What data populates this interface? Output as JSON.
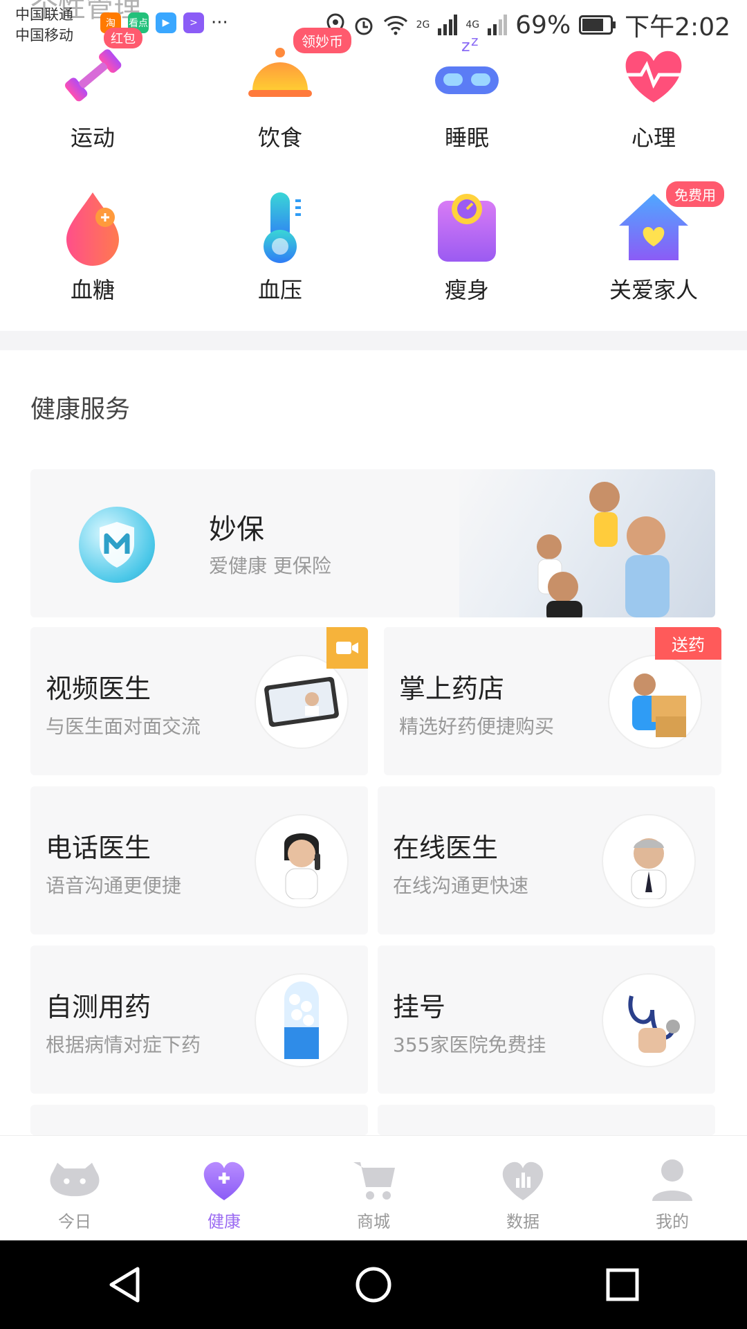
{
  "status_bar": {
    "carrier1": "中国联通",
    "carrier2": "中国移动",
    "faded_title": "个性管理",
    "app_icons": [
      {
        "label": "淘",
        "color": "#ff7a00"
      },
      {
        "label": "看点",
        "color": "#22c07a"
      },
      {
        "label": "▶",
        "color": "#3aa7ff"
      },
      {
        "label": ">",
        "color": "#8b5cf6"
      }
    ],
    "more": "···",
    "signal1": "2G",
    "signal2": "4G",
    "battery": "69%",
    "time": "下午2:02",
    "red_packet_badge": "红包"
  },
  "categories": [
    {
      "label": "运动",
      "icon": "dumbbell-icon"
    },
    {
      "label": "饮食",
      "icon": "food-cloche-icon"
    },
    {
      "label": "睡眠",
      "icon": "sleep-mask-icon"
    },
    {
      "label": "心理",
      "icon": "heart-pulse-icon"
    },
    {
      "label": "血糖",
      "icon": "blood-drop-icon"
    },
    {
      "label": "血压",
      "icon": "thermometer-icon"
    },
    {
      "label": "瘦身",
      "icon": "scale-icon"
    },
    {
      "label": "关爱家人",
      "icon": "house-heart-icon"
    }
  ],
  "badges": {
    "coin": "领妙币",
    "free": "免费用"
  },
  "section_title": "健康服务",
  "banner": {
    "title": "妙保",
    "subtitle": "爱健康 更保险"
  },
  "services": [
    {
      "title": "视频医生",
      "subtitle": "与医生面对面交流"
    },
    {
      "title": "掌上药店",
      "subtitle": "精选好药便捷购买",
      "tag": "送药"
    },
    {
      "title": "电话医生",
      "subtitle": "语音沟通更便捷"
    },
    {
      "title": "在线医生",
      "subtitle": "在线沟通更快速"
    },
    {
      "title": "自测用药",
      "subtitle": "根据病情对症下药"
    },
    {
      "title": "挂号",
      "subtitle": "355家医院免费挂"
    }
  ],
  "tabs": [
    {
      "label": "今日"
    },
    {
      "label": "健康"
    },
    {
      "label": "商城"
    },
    {
      "label": "数据"
    },
    {
      "label": "我的"
    }
  ],
  "colors": {
    "accent": "#9b6bf2",
    "badge_red": "#ff5a6e",
    "inactive_gray": "#c8c8cc"
  }
}
